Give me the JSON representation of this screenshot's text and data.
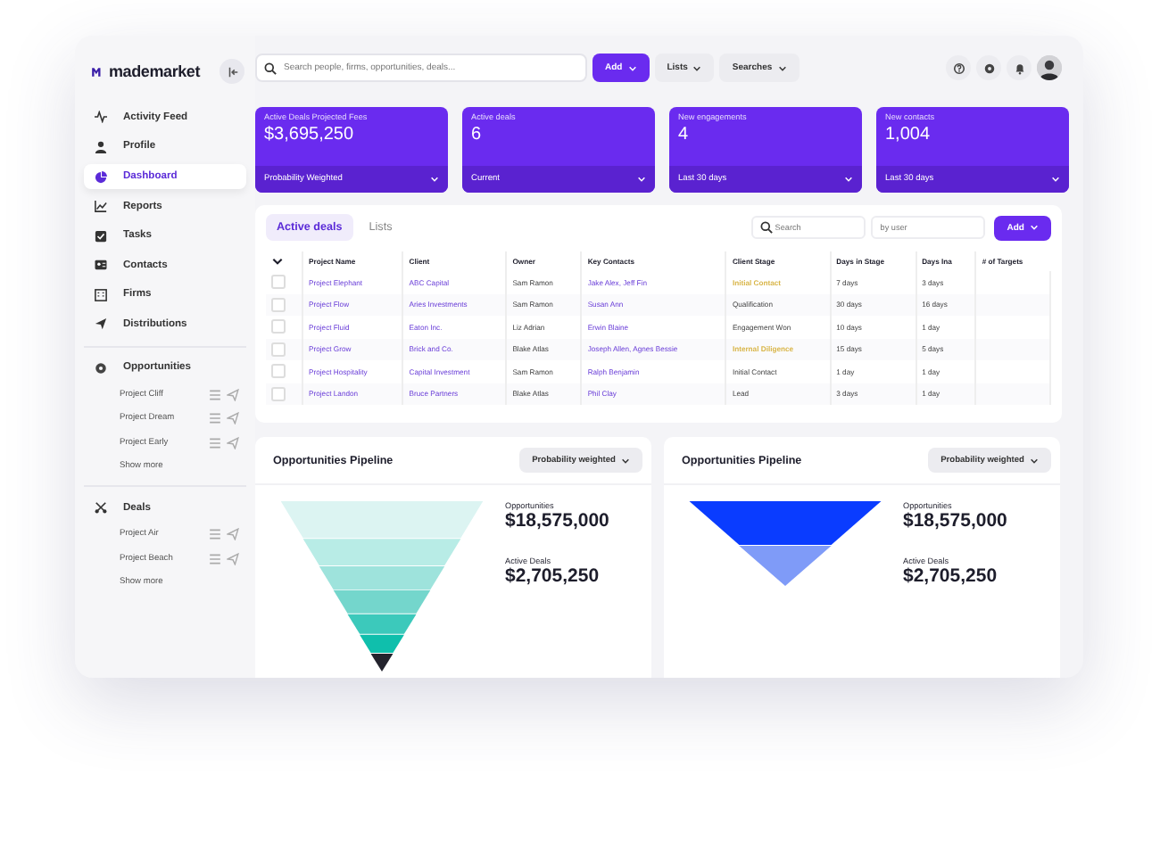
{
  "brand": {
    "name": "mademarket"
  },
  "search": {
    "placeholder": "Search people, firms, opportunities, deals..."
  },
  "toolbar": [
    {
      "label": "Add",
      "kind": "primary"
    },
    {
      "label": "Lists",
      "kind": "plain"
    },
    {
      "label": "Searches",
      "kind": "plain"
    }
  ],
  "sidebar": {
    "items": [
      {
        "label": "Activity Feed",
        "selected": false
      },
      {
        "label": "Profile",
        "selected": false
      },
      {
        "label": "Dashboard",
        "selected": true
      },
      {
        "label": "Reports",
        "selected": false
      },
      {
        "label": "Tasks",
        "selected": false
      },
      {
        "label": "Contacts",
        "selected": false
      },
      {
        "label": "Firms",
        "selected": false
      },
      {
        "label": "Distributions",
        "selected": false
      }
    ],
    "sections": [
      {
        "title": "Opportunities",
        "items": [
          "Project Cliff",
          "Project Dream",
          "Project Early"
        ],
        "more": "Show more"
      },
      {
        "title": "Deals",
        "items": [
          "Project Air",
          "Project Beach"
        ],
        "more": "Show more"
      }
    ]
  },
  "stats": [
    {
      "label": "Active Deals Projected Fees",
      "value": "$3,695,250",
      "filter": "Probability Weighted"
    },
    {
      "label": "Active deals",
      "value": "6",
      "filter": "Current"
    },
    {
      "label": "New engagements",
      "value": "4",
      "filter": "Last 30 days"
    },
    {
      "label": "New contacts",
      "value": "1,004",
      "filter": "Last 30 days"
    }
  ],
  "deals": {
    "tabs": [
      {
        "label": "Active deals",
        "selected": true
      },
      {
        "label": "Lists",
        "selected": false
      }
    ],
    "search_placeholder": "Search",
    "user_placeholder": "by user",
    "add": "Add",
    "columns": [
      {
        "label": "Project Name",
        "kind": "link"
      },
      {
        "label": "Client",
        "kind": "link"
      },
      {
        "label": "Owner",
        "kind": "text"
      },
      {
        "label": "Key Contacts",
        "kind": "link"
      },
      {
        "label": "Client Stage",
        "kind": "stage"
      },
      {
        "label": "Days in Stage",
        "kind": "text"
      },
      {
        "label": "Days Ina",
        "kind": "text"
      },
      {
        "label": "# of Targets",
        "kind": "count"
      }
    ],
    "rows": [
      {
        "checked": false,
        "highlight": true,
        "cells": [
          "Project Elephant",
          "ABC Capital",
          "Sam Ramon",
          "Jake Alex, Jeff Fin",
          "Initial Contact",
          "7 days",
          "3 days"
        ]
      },
      {
        "checked": false,
        "highlight": false,
        "cells": [
          "Project Flow",
          "Aries Investments",
          "Sam Ramon",
          "Susan Ann",
          "Qualification",
          "30 days",
          "16 days"
        ]
      },
      {
        "checked": false,
        "highlight": false,
        "cells": [
          "Project Fluid",
          "Eaton Inc.",
          "Liz Adrian",
          "Erwin Blaine",
          "Engagement Won",
          "10 days",
          "1 day"
        ]
      },
      {
        "checked": false,
        "highlight": true,
        "cells": [
          "Project Grow",
          "Brick and Co.",
          "Blake Atlas",
          "Joseph Allen, Agnes Bessie",
          "Internal Diligence",
          "15 days",
          "5 days"
        ]
      },
      {
        "checked": false,
        "highlight": false,
        "cells": [
          "Project Hospitality",
          "Capital Investment",
          "Sam Ramon",
          "Ralph Benjamin",
          "Initial Contact",
          "1 day",
          "1 day"
        ]
      },
      {
        "checked": false,
        "highlight": false,
        "cells": [
          "Project Landon",
          "Bruce Partners",
          "Blake Atlas",
          "Phil Clay",
          "Lead",
          "3 days",
          "1 day"
        ]
      }
    ]
  },
  "pipelines": [
    {
      "title": "Opportunities Pipeline",
      "filter": "Probability weighted",
      "kind": "teal",
      "stats": [
        {
          "label": "Opportunities",
          "value": "$18,575,000"
        },
        {
          "label": "Active Deals",
          "value": "$2,705,250"
        }
      ]
    },
    {
      "title": "Opportunities Pipeline",
      "filter": "Probability weighted",
      "kind": "blue",
      "stats": [
        {
          "label": "Opportunities",
          "value": "$18,575,000"
        },
        {
          "label": "Active Deals",
          "value": "$2,705,250"
        }
      ]
    }
  ]
}
